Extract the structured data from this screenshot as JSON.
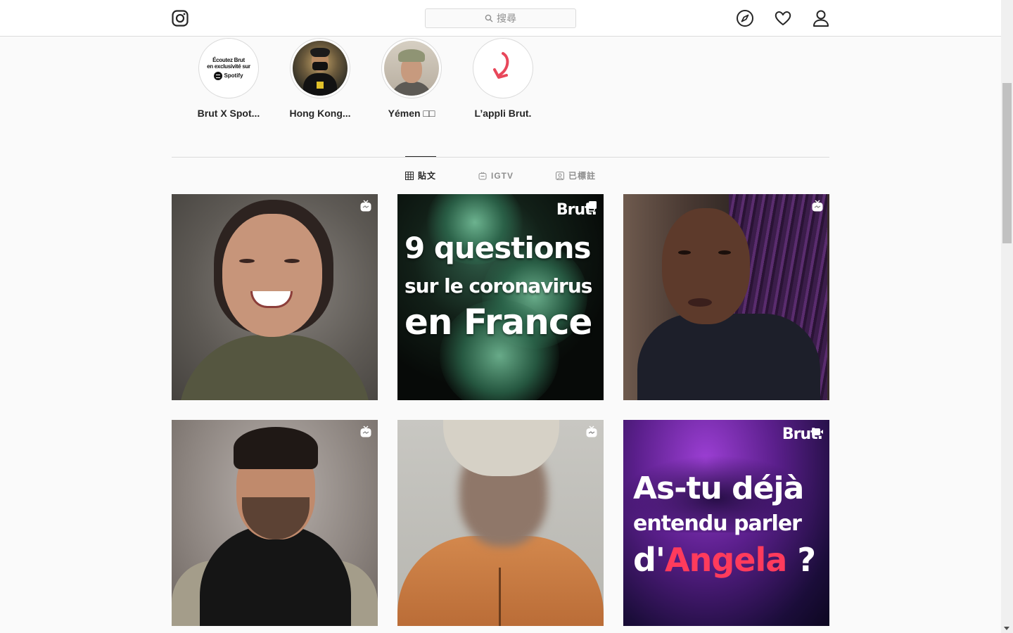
{
  "nav": {
    "search_placeholder": "搜尋"
  },
  "highlights": [
    {
      "label": "Brut X Spot...",
      "cover_line1": "Écoutez Brut",
      "cover_line2": "en exclusivité sur",
      "cover_brand": "Spotify"
    },
    {
      "label": "Hong Kong..."
    },
    {
      "label": "Yémen □□"
    },
    {
      "label": "L’appli Brut."
    }
  ],
  "tabs": [
    {
      "label": "貼文",
      "icon": "grid-icon",
      "active": true
    },
    {
      "label": "IGTV",
      "icon": "igtv-icon",
      "active": false
    },
    {
      "label": "已標註",
      "icon": "tagged-icon",
      "active": false
    }
  ],
  "posts": [
    {
      "type": "igtv",
      "badge_icon": "igtv-icon"
    },
    {
      "type": "carousel",
      "badge_icon": "carousel-icon",
      "brand": "Brut.",
      "line1": "9 questions",
      "line2": "sur le coronavirus",
      "line3": "en  France"
    },
    {
      "type": "igtv",
      "badge_icon": "igtv-icon"
    },
    {
      "type": "igtv",
      "badge_icon": "igtv-icon"
    },
    {
      "type": "igtv",
      "badge_icon": "igtv-icon"
    },
    {
      "type": "video",
      "badge_icon": "video-icon",
      "brand": "Brut.",
      "line1": "As-tu déjà",
      "line2": "entendu parler",
      "line3_prefix": "d'",
      "line3_accent": "Angela",
      "line3_suffix": " ?"
    }
  ],
  "colors": {
    "accent_red": "#ff3b5c",
    "border": "#dbdbdb",
    "muted_text": "#8e8e8e",
    "text": "#262626"
  }
}
